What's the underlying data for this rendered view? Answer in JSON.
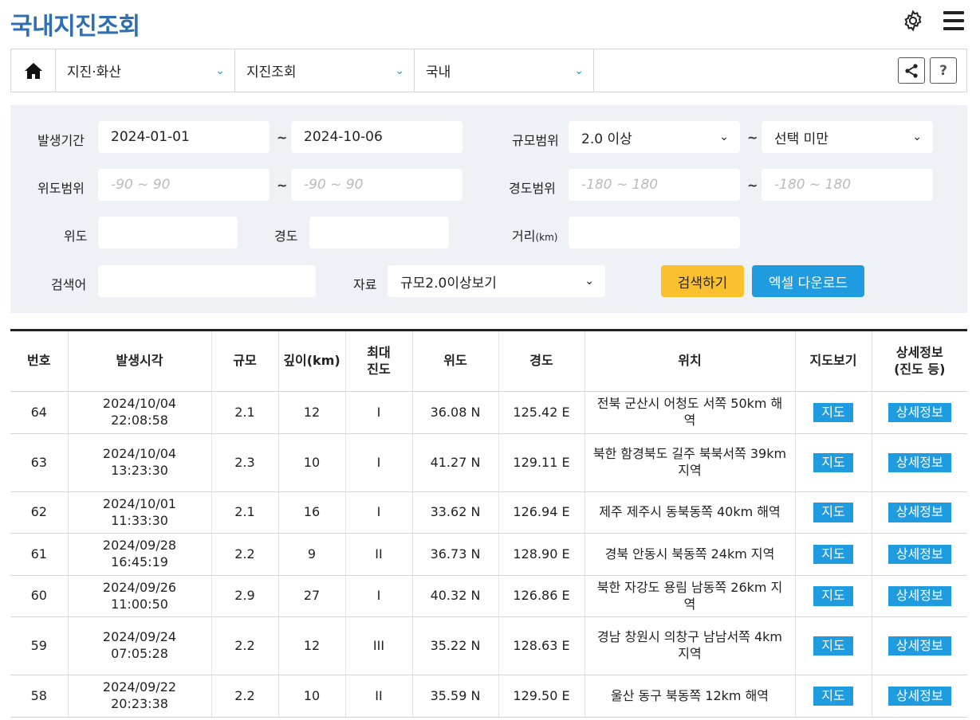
{
  "page": {
    "title": "국내지진조회"
  },
  "nav": {
    "items": [
      {
        "label": "지진·화산"
      },
      {
        "label": "지진조회"
      },
      {
        "label": "국내"
      }
    ],
    "help_label": "?"
  },
  "filter": {
    "period_label": "발생기간",
    "period_from": "2024-01-01",
    "period_to": "2024-10-06",
    "magnitude_label": "규모범위",
    "magnitude_from": "2.0 이상",
    "magnitude_to": "선택 미만",
    "lat_range_label": "위도범위",
    "lat_from_placeholder": "-90 ~ 90",
    "lat_to_placeholder": "-90 ~ 90",
    "lon_range_label": "경도범위",
    "lon_from_placeholder": "-180 ~ 180",
    "lon_to_placeholder": "-180 ~ 180",
    "lat_label": "위도",
    "lon_label": "경도",
    "distance_label": "거리",
    "distance_unit": "(km)",
    "keyword_label": "검색어",
    "data_label": "자료",
    "data_value": "규모2.0이상보기",
    "tilde": "~",
    "search_button": "검색하기",
    "excel_button": "엑셀 다운로드"
  },
  "table": {
    "headers": {
      "no": "번호",
      "time": "발생시각",
      "mag": "규모",
      "depth": "깊이(km)",
      "intensity_l1": "최대",
      "intensity_l2": "진도",
      "lat": "위도",
      "lon": "경도",
      "loc": "위치",
      "map": "지도보기",
      "detail_l1": "상세정보",
      "detail_l2": "(진도 등)"
    },
    "map_label": "지도",
    "detail_label": "상세정보",
    "rows": [
      {
        "no": "64",
        "time": "2024/10/04 22:08:58",
        "mag": "2.1",
        "depth": "12",
        "intensity": "I",
        "lat": "36.08 N",
        "lon": "125.42 E",
        "loc": "전북 군산시 어청도 서쪽 50km 해역"
      },
      {
        "no": "63",
        "time": "2024/10/04 13:23:30",
        "mag": "2.3",
        "depth": "10",
        "intensity": "I",
        "lat": "41.27 N",
        "lon": "129.11 E",
        "loc": "북한 함경북도 길주 북북서쪽 39km 지역"
      },
      {
        "no": "62",
        "time": "2024/10/01 11:33:30",
        "mag": "2.1",
        "depth": "16",
        "intensity": "I",
        "lat": "33.62 N",
        "lon": "126.94 E",
        "loc": "제주 제주시 동북동쪽 40km 해역"
      },
      {
        "no": "61",
        "time": "2024/09/28 16:45:19",
        "mag": "2.2",
        "depth": "9",
        "intensity": "II",
        "lat": "36.73 N",
        "lon": "128.90 E",
        "loc": "경북 안동시 북동쪽 24km 지역"
      },
      {
        "no": "60",
        "time": "2024/09/26 11:00:50",
        "mag": "2.9",
        "depth": "27",
        "intensity": "I",
        "lat": "40.32 N",
        "lon": "126.86 E",
        "loc": "북한 자강도 용림 남동쪽 26km 지역"
      },
      {
        "no": "59",
        "time": "2024/09/24 07:05:28",
        "mag": "2.2",
        "depth": "12",
        "intensity": "III",
        "lat": "35.22 N",
        "lon": "128.63 E",
        "loc": "경남 창원시 의창구 남남서쪽 4km 지역"
      },
      {
        "no": "58",
        "time": "2024/09/22 20:23:38",
        "mag": "2.2",
        "depth": "10",
        "intensity": "II",
        "lat": "35.59 N",
        "lon": "129.50 E",
        "loc": "울산 동구 북동쪽 12km 해역"
      }
    ]
  }
}
